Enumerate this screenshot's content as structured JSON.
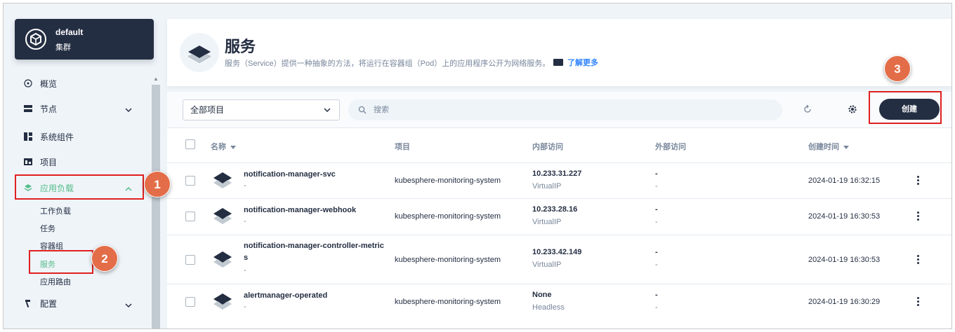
{
  "cluster": {
    "name": "default",
    "label": "集群"
  },
  "nav": [
    {
      "label": "概览",
      "icon": "dashboard-icon"
    },
    {
      "label": "节点",
      "icon": "nodes-icon"
    },
    {
      "label": "系统组件",
      "icon": "components-icon"
    },
    {
      "label": "项目",
      "icon": "project-icon"
    },
    {
      "label": "应用负载",
      "icon": "appcenter-icon",
      "active": true
    },
    {
      "label": "配置",
      "icon": "hammer-icon"
    }
  ],
  "subnav": [
    {
      "label": "工作负载"
    },
    {
      "label": "任务"
    },
    {
      "label": "容器组"
    },
    {
      "label": "服务",
      "active": true
    },
    {
      "label": "应用路由"
    }
  ],
  "badges": [
    "1",
    "2",
    "3"
  ],
  "header": {
    "title": "服务",
    "description": "服务（Service）提供一种抽象的方法，将运行在容器组（Pod）上的应用程序公开为网络服务。",
    "learn_more": "了解更多"
  },
  "toolbar": {
    "project_select": "全部项目",
    "search_placeholder": "搜索",
    "create_label": "创建"
  },
  "table": {
    "columns": [
      "名称",
      "项目",
      "内部访问",
      "外部访问",
      "创建时间"
    ],
    "rows": [
      {
        "name": "notification-manager-svc",
        "name2": "",
        "desc": "-",
        "project": "kubesphere-monitoring-system",
        "internal_ip": "10.233.31.227",
        "internal_type": "VirtualIP",
        "external": "-",
        "external_sub": "-",
        "created": "2024-01-19 16:32:15"
      },
      {
        "name": "notification-manager-webhook",
        "name2": "",
        "desc": "-",
        "project": "kubesphere-monitoring-system",
        "internal_ip": "10.233.28.16",
        "internal_type": "VirtualIP",
        "external": "-",
        "external_sub": "-",
        "created": "2024-01-19 16:30:53"
      },
      {
        "name": "notification-manager-controller-metric",
        "name2": "s",
        "desc": "-",
        "project": "kubesphere-monitoring-system",
        "internal_ip": "10.233.42.149",
        "internal_type": "VirtualIP",
        "external": "-",
        "external_sub": "-",
        "created": "2024-01-19 16:30:53"
      },
      {
        "name": "alertmanager-operated",
        "name2": "",
        "desc": "-",
        "project": "kubesphere-monitoring-system",
        "internal_ip": "None",
        "internal_type": "Headless",
        "external": "-",
        "external_sub": "-",
        "created": "2024-01-19 16:30:29"
      }
    ]
  },
  "colors": {
    "accent": "#242e42",
    "active_green": "#55bc8a",
    "highlight": "#e02020",
    "badge": "#e36d48"
  }
}
